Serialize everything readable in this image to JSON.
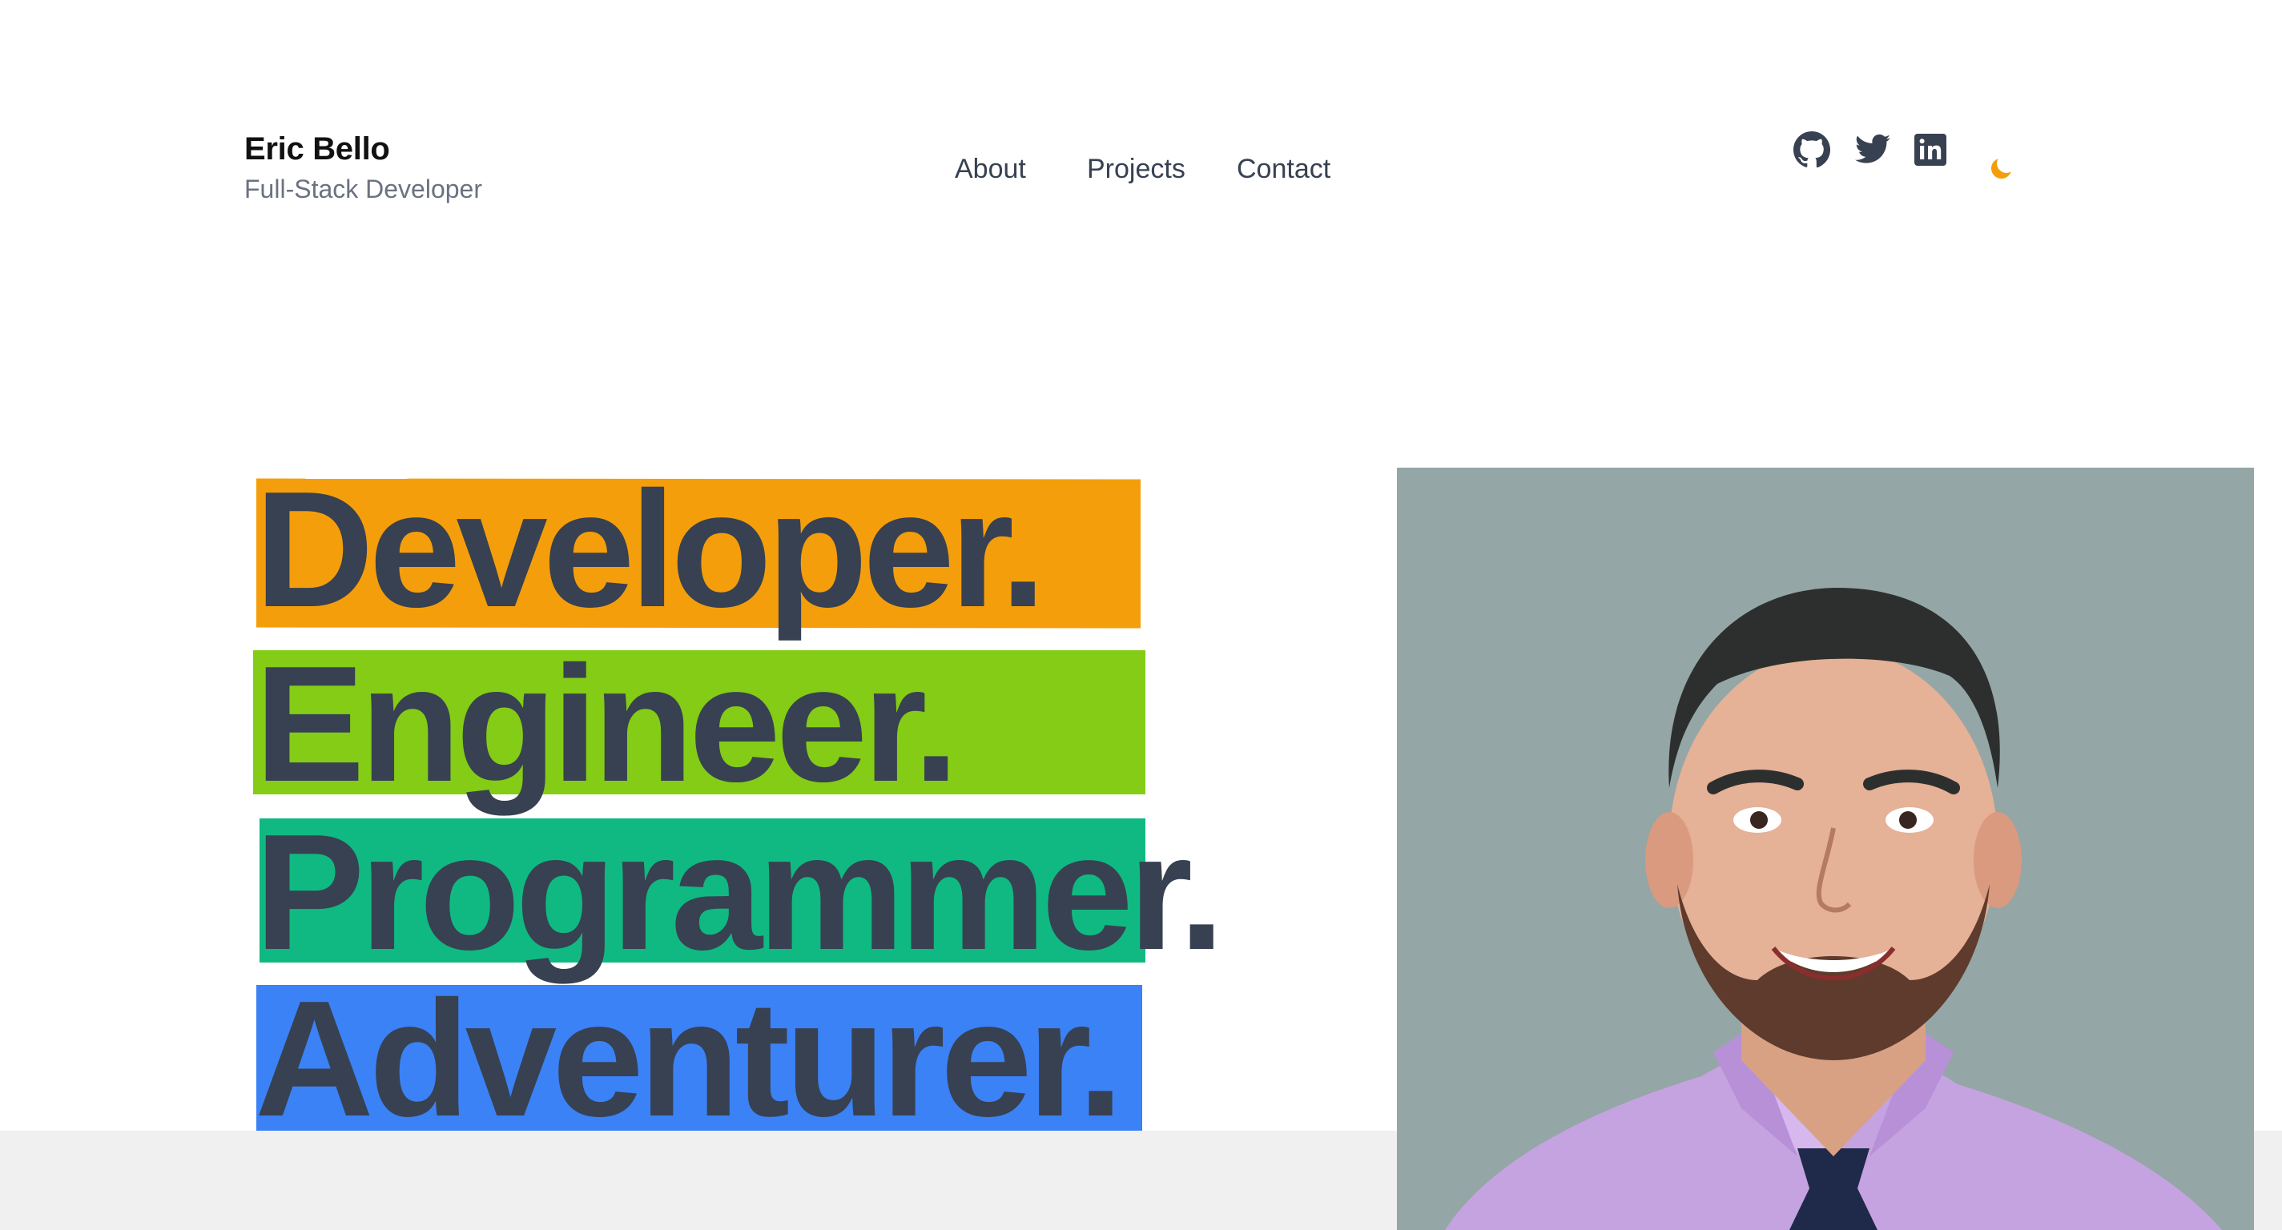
{
  "brand": {
    "name": "Eric Bello",
    "subtitle": "Full-Stack Developer"
  },
  "nav": {
    "items": [
      {
        "label": "About"
      },
      {
        "label": "Projects"
      },
      {
        "label": "Contact"
      }
    ]
  },
  "social": {
    "icons": [
      "github-icon",
      "twitter-icon",
      "linkedin-icon"
    ],
    "theme_toggle_icon": "moon-icon",
    "theme_toggle_color": "#f59e0b",
    "icon_color": "#374151"
  },
  "hero": {
    "lines": [
      {
        "text": "Developer.",
        "highlight": "#f59e0b"
      },
      {
        "text": "Engineer.",
        "highlight": "#84cc16"
      },
      {
        "text": "Programmer.",
        "highlight": "#10b981"
      },
      {
        "text": "Adventurer.",
        "highlight": "#3b82f6"
      }
    ]
  },
  "portrait": {
    "background": "#94a6a6"
  }
}
